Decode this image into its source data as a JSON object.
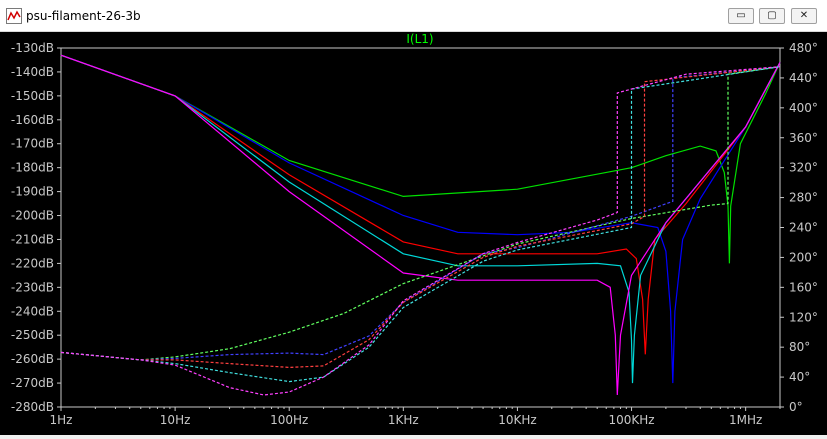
{
  "window": {
    "title": "psu-filament-26-3b",
    "minimize_glyph": "▭",
    "maximize_glyph": "▢",
    "close_glyph": "✕",
    "app_icon": "waveform-chart-icon"
  },
  "chart_data": {
    "type": "line",
    "title": "I(L1)",
    "x_scale": "log",
    "xlim": [
      1,
      2000000
    ],
    "x_ticks": [
      {
        "value": 1,
        "label": "1Hz"
      },
      {
        "value": 10,
        "label": "10Hz"
      },
      {
        "value": 100,
        "label": "100Hz"
      },
      {
        "value": 1000,
        "label": "1KHz"
      },
      {
        "value": 10000,
        "label": "10KHz"
      },
      {
        "value": 100000,
        "label": "100KHz"
      },
      {
        "value": 1000000,
        "label": "1MHz"
      }
    ],
    "ylim_left": [
      -280,
      -125
    ],
    "y_ticks_left": [
      {
        "value": -130,
        "label": "-130dB"
      },
      {
        "value": -140,
        "label": "-140dB"
      },
      {
        "value": -150,
        "label": "-150dB"
      },
      {
        "value": -160,
        "label": "-160dB"
      },
      {
        "value": -170,
        "label": "-170dB"
      },
      {
        "value": -180,
        "label": "-180dB"
      },
      {
        "value": -190,
        "label": "-190dB"
      },
      {
        "value": -200,
        "label": "-200dB"
      },
      {
        "value": -210,
        "label": "-210dB"
      },
      {
        "value": -220,
        "label": "-220dB"
      },
      {
        "value": -230,
        "label": "-230dB"
      },
      {
        "value": -240,
        "label": "-240dB"
      },
      {
        "value": -250,
        "label": "-250dB"
      },
      {
        "value": -260,
        "label": "-260dB"
      },
      {
        "value": -270,
        "label": "-270dB"
      },
      {
        "value": -280,
        "label": "-280dB"
      }
    ],
    "ylim_right": [
      0,
      500
    ],
    "y_ticks_right": [
      {
        "value": 0,
        "label": "0°"
      },
      {
        "value": 40,
        "label": "40°"
      },
      {
        "value": 80,
        "label": "80°"
      },
      {
        "value": 120,
        "label": "120°"
      },
      {
        "value": 160,
        "label": "160°"
      },
      {
        "value": 200,
        "label": "200°"
      },
      {
        "value": 240,
        "label": "240°"
      },
      {
        "value": 280,
        "label": "280°"
      },
      {
        "value": 320,
        "label": "320°"
      },
      {
        "value": 360,
        "label": "360°"
      },
      {
        "value": 400,
        "label": "400°"
      },
      {
        "value": 440,
        "label": "440°"
      },
      {
        "value": 480,
        "label": "480°"
      }
    ],
    "grid": false,
    "colors": {
      "background": "#000000",
      "axis": "#c8c8c8",
      "title": "#00ff00"
    },
    "series": [
      {
        "color": "#00e000",
        "axis": "magnitude",
        "points": [
          [
            1,
            -133
          ],
          [
            10,
            -150
          ],
          [
            100,
            -177
          ],
          [
            1000,
            -192
          ],
          [
            10000,
            -189
          ],
          [
            100000,
            -180
          ],
          [
            200000,
            -175
          ],
          [
            400000,
            -171
          ],
          [
            550000,
            -173
          ],
          [
            650000,
            -182
          ],
          [
            700000,
            -196
          ],
          [
            720000,
            -220
          ],
          [
            740000,
            -196
          ],
          [
            900000,
            -170
          ],
          [
            1500000,
            -149
          ],
          [
            2000000,
            -136
          ]
        ]
      },
      {
        "color": "#0000ff",
        "axis": "magnitude",
        "points": [
          [
            1,
            -133
          ],
          [
            10,
            -150
          ],
          [
            100,
            -178
          ],
          [
            1000,
            -200
          ],
          [
            3000,
            -207
          ],
          [
            10000,
            -208
          ],
          [
            30000,
            -207
          ],
          [
            100000,
            -203
          ],
          [
            170000,
            -205
          ],
          [
            200000,
            -215
          ],
          [
            220000,
            -240
          ],
          [
            230000,
            -270
          ],
          [
            240000,
            -240
          ],
          [
            280000,
            -210
          ],
          [
            400000,
            -193
          ],
          [
            1000000,
            -163
          ],
          [
            2000000,
            -136
          ]
        ]
      },
      {
        "color": "#ff0000",
        "axis": "magnitude",
        "points": [
          [
            1,
            -133
          ],
          [
            10,
            -150
          ],
          [
            100,
            -183
          ],
          [
            1000,
            -211
          ],
          [
            3000,
            -216
          ],
          [
            10000,
            -216
          ],
          [
            50000,
            -216
          ],
          [
            90000,
            -214
          ],
          [
            110000,
            -218
          ],
          [
            125000,
            -235
          ],
          [
            132000,
            -258
          ],
          [
            140000,
            -235
          ],
          [
            160000,
            -210
          ],
          [
            300000,
            -195
          ],
          [
            1000000,
            -163
          ],
          [
            2000000,
            -136
          ]
        ]
      },
      {
        "color": "#00d8d8",
        "axis": "magnitude",
        "points": [
          [
            1,
            -133
          ],
          [
            10,
            -150
          ],
          [
            100,
            -186
          ],
          [
            1000,
            -216
          ],
          [
            3000,
            -221
          ],
          [
            10000,
            -221
          ],
          [
            50000,
            -220
          ],
          [
            80000,
            -221
          ],
          [
            95000,
            -232
          ],
          [
            100000,
            -252
          ],
          [
            102000,
            -270
          ],
          [
            106000,
            -250
          ],
          [
            120000,
            -225
          ],
          [
            200000,
            -203
          ],
          [
            1000000,
            -163
          ],
          [
            2000000,
            -136
          ]
        ]
      },
      {
        "color": "#ff00ff",
        "axis": "magnitude",
        "points": [
          [
            1,
            -133
          ],
          [
            10,
            -150
          ],
          [
            100,
            -190
          ],
          [
            1000,
            -224
          ],
          [
            3000,
            -227
          ],
          [
            10000,
            -227
          ],
          [
            50000,
            -227
          ],
          [
            65000,
            -230
          ],
          [
            72000,
            -250
          ],
          [
            75000,
            -275
          ],
          [
            80000,
            -250
          ],
          [
            100000,
            -225
          ],
          [
            200000,
            -203
          ],
          [
            1000000,
            -163
          ],
          [
            2000000,
            -136
          ]
        ]
      },
      {
        "color": "#60ff60",
        "axis": "phase",
        "dashed": true,
        "points": [
          [
            1,
            73
          ],
          [
            5,
            63
          ],
          [
            10,
            67
          ],
          [
            30,
            78
          ],
          [
            100,
            100
          ],
          [
            300,
            125
          ],
          [
            1000,
            165
          ],
          [
            10000,
            218
          ],
          [
            100000,
            252
          ],
          [
            500000,
            270
          ],
          [
            700000,
            272
          ],
          [
            700000,
            445
          ],
          [
            2000000,
            455
          ]
        ]
      },
      {
        "color": "#4040ff",
        "axis": "phase",
        "dashed": true,
        "points": [
          [
            1,
            73
          ],
          [
            5,
            63
          ],
          [
            10,
            65
          ],
          [
            30,
            70
          ],
          [
            100,
            72
          ],
          [
            200,
            70
          ],
          [
            500,
            95
          ],
          [
            1000,
            140
          ],
          [
            5000,
            205
          ],
          [
            10000,
            213
          ],
          [
            100000,
            255
          ],
          [
            230000,
            275
          ],
          [
            230000,
            440
          ],
          [
            2000000,
            455
          ]
        ]
      },
      {
        "color": "#ff4040",
        "axis": "phase",
        "dashed": true,
        "points": [
          [
            1,
            73
          ],
          [
            5,
            63
          ],
          [
            10,
            63
          ],
          [
            30,
            58
          ],
          [
            100,
            53
          ],
          [
            200,
            55
          ],
          [
            500,
            90
          ],
          [
            1000,
            140
          ],
          [
            5000,
            200
          ],
          [
            10000,
            215
          ],
          [
            100000,
            245
          ],
          [
            130000,
            255
          ],
          [
            130000,
            435
          ],
          [
            2000000,
            455
          ]
        ]
      },
      {
        "color": "#40e0e0",
        "axis": "phase",
        "dashed": true,
        "points": [
          [
            1,
            73
          ],
          [
            5,
            63
          ],
          [
            10,
            58
          ],
          [
            30,
            46
          ],
          [
            100,
            34
          ],
          [
            200,
            40
          ],
          [
            500,
            80
          ],
          [
            1000,
            133
          ],
          [
            5000,
            195
          ],
          [
            10000,
            210
          ],
          [
            100000,
            240
          ],
          [
            100000,
            425
          ],
          [
            2000000,
            455
          ]
        ]
      },
      {
        "color": "#ff40ff",
        "axis": "phase",
        "dashed": true,
        "points": [
          [
            1,
            73
          ],
          [
            5,
            63
          ],
          [
            10,
            56
          ],
          [
            30,
            26
          ],
          [
            60,
            16
          ],
          [
            100,
            20
          ],
          [
            200,
            40
          ],
          [
            500,
            83
          ],
          [
            1000,
            142
          ],
          [
            5000,
            205
          ],
          [
            10000,
            220
          ],
          [
            50000,
            250
          ],
          [
            75000,
            260
          ],
          [
            75000,
            420
          ],
          [
            300000,
            445
          ],
          [
            2000000,
            455
          ]
        ]
      }
    ]
  }
}
